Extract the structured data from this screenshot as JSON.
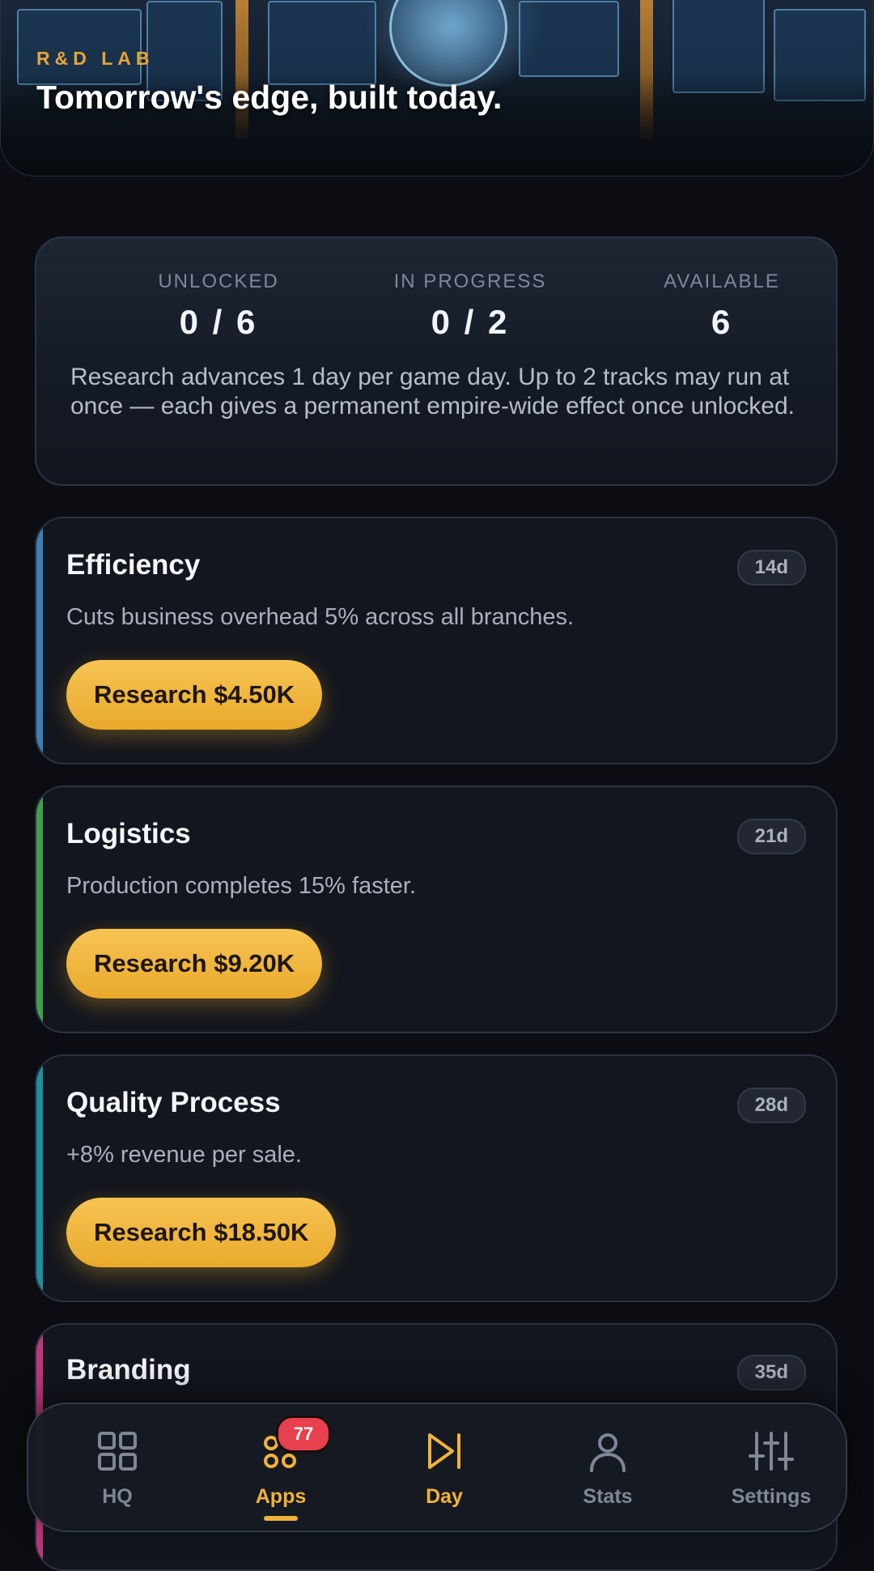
{
  "hero": {
    "tag": "R&D LAB",
    "title": "Tomorrow's edge, built today."
  },
  "stats": {
    "unlocked": {
      "label": "UNLOCKED",
      "value": "0 / 6"
    },
    "in_progress": {
      "label": "IN PROGRESS",
      "value": "0 / 2"
    },
    "available": {
      "label": "AVAILABLE",
      "value": "6"
    },
    "description": "Research advances 1 day per game day. Up to 2 tracks may run at once — each gives a permanent empire-wide effect once unlocked."
  },
  "research": [
    {
      "title": "Efficiency",
      "days": "14d",
      "description": "Cuts business overhead 5% across all branches.",
      "button": "Research $4.50K",
      "accent": "#3d7fb6"
    },
    {
      "title": "Logistics",
      "days": "21d",
      "description": "Production completes 15% faster.",
      "button": "Research $9.20K",
      "accent": "#3ea14c"
    },
    {
      "title": "Quality Process",
      "days": "28d",
      "description": "+8% revenue per sale.",
      "button": "Research $18.50K",
      "accent": "#1f8ea3"
    },
    {
      "title": "Branding",
      "days": "35d",
      "description": "",
      "button": "",
      "accent": "#c2367a"
    }
  ],
  "nav": {
    "items": [
      {
        "label": "HQ",
        "icon": "grid-icon"
      },
      {
        "label": "Apps",
        "icon": "apps-icon",
        "badge": "77",
        "active": true
      },
      {
        "label": "Day",
        "icon": "skip-forward-icon"
      },
      {
        "label": "Stats",
        "icon": "person-icon"
      },
      {
        "label": "Settings",
        "icon": "sliders-icon"
      }
    ]
  },
  "colors": {
    "accent_gold": "#f0b23a",
    "badge_red": "#e8404e",
    "background": "#0b0d12"
  }
}
